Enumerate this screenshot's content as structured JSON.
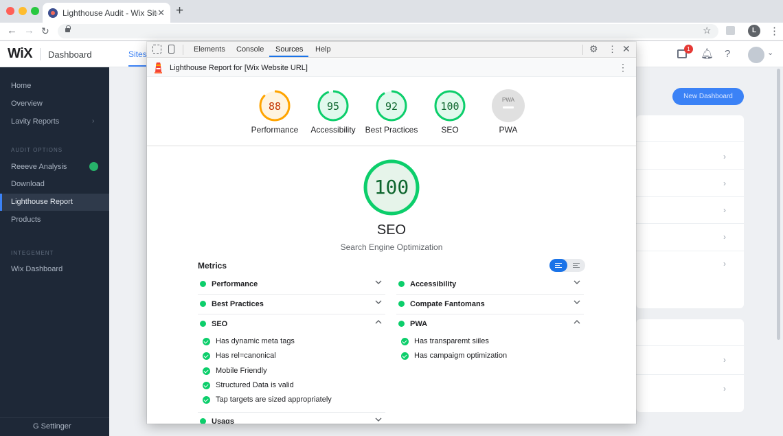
{
  "browser": {
    "tab_title": "Lighthouse Audit - Wix Site",
    "profile_initial": "L"
  },
  "wix": {
    "logo": "WiX",
    "dashboard_label": "Dashboard",
    "site_tab": "Sites",
    "notification_count": "1",
    "new_button": "New Dashboard",
    "sidebar": {
      "items": [
        "Home",
        "Overview",
        "Lavity Reports"
      ],
      "section_audit": "AUDIT OPTIONS",
      "audit_items": [
        "Reeeve Analysis",
        "Download",
        "Lighthouse Report",
        "Products"
      ],
      "section_integ": "INTEGEMENT",
      "integ_items": [
        "Wix Dashboard"
      ],
      "settings": "G  Settinger"
    }
  },
  "devtools": {
    "tabs": [
      "Elements",
      "Console",
      "Sources",
      "Help"
    ],
    "active_tab": "Sources",
    "report_title": "Lighthouse Report for [Wix Website URL]"
  },
  "colors": {
    "pass": "#0cce6b",
    "average": "#ffa400",
    "accent": "#1a73e8"
  },
  "scores": [
    {
      "label": "Performance",
      "value": "88",
      "color": "#ffa400",
      "fill": 0.88
    },
    {
      "label": "Accessibility",
      "value": "95",
      "color": "#0cce6b",
      "fill": 0.95
    },
    {
      "label": "Best Practices",
      "value": "92",
      "color": "#0cce6b",
      "fill": 0.92
    },
    {
      "label": "SEO",
      "value": "100",
      "color": "#0cce6b",
      "fill": 1.0
    },
    {
      "label": "PWA",
      "value": "PWA",
      "color": "#9e9e9e",
      "fill": 0
    }
  ],
  "focus": {
    "score": "100",
    "title": "SEO",
    "subtitle": "Search Engine Optimization"
  },
  "metrics": {
    "title": "Metrics",
    "left": [
      {
        "label": "Performance",
        "expanded": false
      },
      {
        "label": "Best Practices",
        "expanded": false
      },
      {
        "label": "SEO",
        "expanded": true,
        "audits": [
          "Has dynamic meta tags",
          "Has rel=canonical",
          "Mobile Friendly",
          "Structured Data is valid",
          "Tap targets are sized appropriately"
        ]
      },
      {
        "label": "Usags",
        "expanded": false
      }
    ],
    "right": [
      {
        "label": "Accessibility",
        "expanded": false
      },
      {
        "label": "Compate Fantomans",
        "expanded": false
      },
      {
        "label": "PWA",
        "expanded": true,
        "audits": [
          "Has transparemt siiles",
          "Has campaigm optimization"
        ]
      }
    ]
  }
}
